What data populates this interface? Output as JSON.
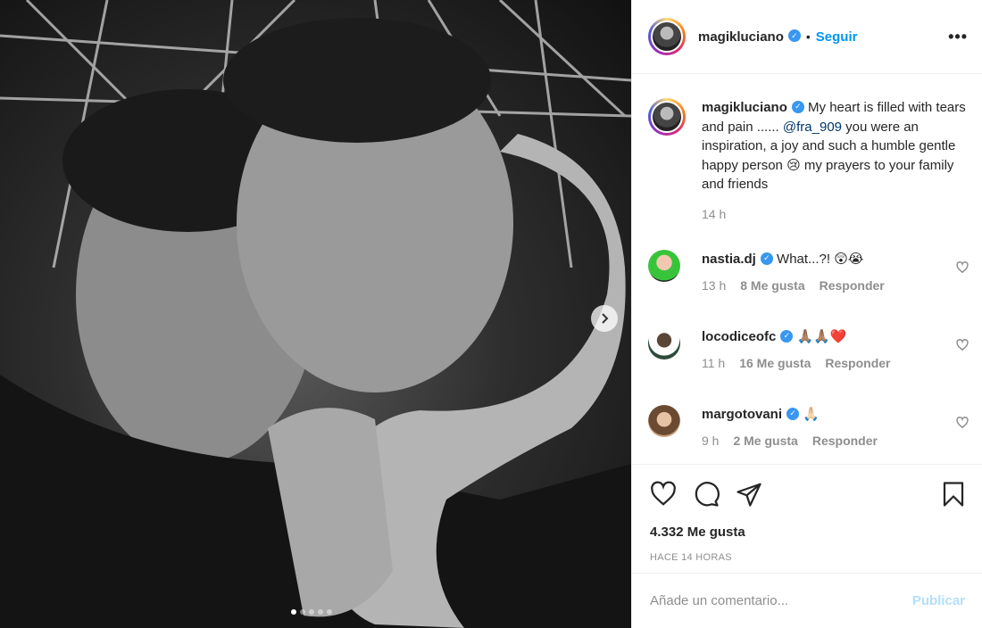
{
  "post": {
    "username": "magikluciano",
    "follow_label": "Seguir",
    "separator": "•",
    "more_icon": "more-horizontal-icon",
    "carousel": {
      "total_images": 5,
      "active_index": 0
    }
  },
  "caption": {
    "username": "magikluciano",
    "text_1": " My heart is filled with tears and pain ...... ",
    "mention": "@fra_909",
    "text_2": " you were an inspiration, a joy and such a humble gentle happy person 😢 my prayers to your family and friends",
    "time": "14 h"
  },
  "comments": [
    {
      "username": "nastia.dj",
      "text": "What...?! 😲😭",
      "time": "13 h",
      "likes": "8 Me gusta",
      "reply": "Responder"
    },
    {
      "username": "locodiceofc",
      "text": "🙏🏽🙏🏽❤️",
      "time": "11 h",
      "likes": "16 Me gusta",
      "reply": "Responder"
    },
    {
      "username": "margotovani",
      "text": "🙏🏻",
      "time": "9 h",
      "likes": "2 Me gusta",
      "reply": "Responder"
    }
  ],
  "footer": {
    "likes": "4.332 Me gusta",
    "posted": "HACE 14 HORAS",
    "comment_placeholder": "Añade un comentario...",
    "publish_label": "Publicar"
  },
  "colors": {
    "accent": "#0095f6",
    "verified": "#3897f0",
    "publish_disabled": "#b2dffc",
    "muted": "#8e8e8e"
  }
}
